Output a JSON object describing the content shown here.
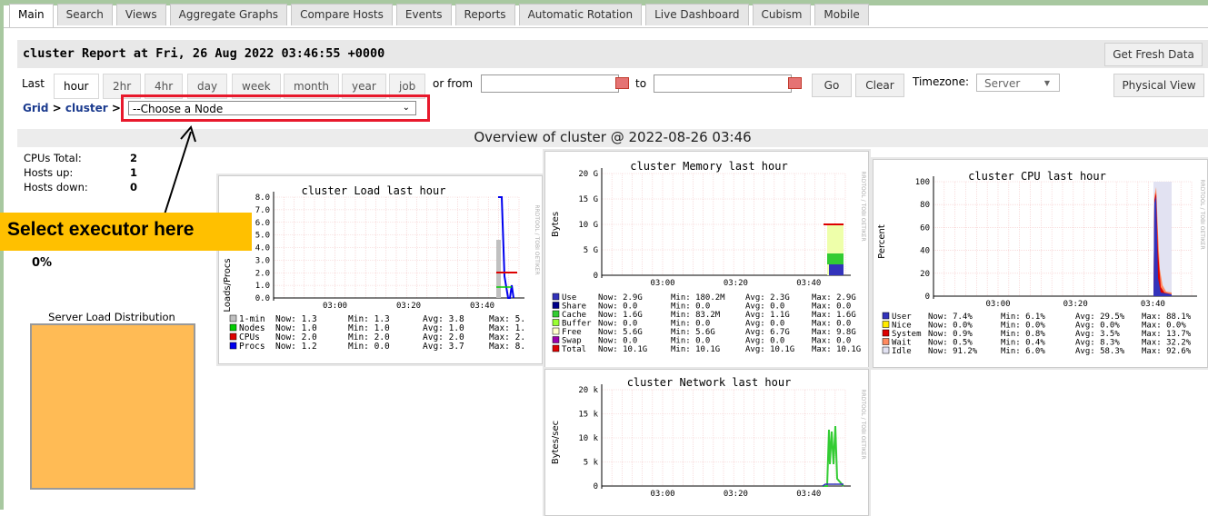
{
  "tabs": [
    "Main",
    "Search",
    "Views",
    "Aggregate Graphs",
    "Compare Hosts",
    "Events",
    "Reports",
    "Automatic Rotation",
    "Live Dashboard",
    "Cubism",
    "Mobile"
  ],
  "report_title": "cluster Report at Fri, 26 Aug 2022 03:46:55 +0000",
  "get_fresh_data": "Get Fresh Data",
  "range": {
    "last_label": "Last",
    "options": [
      "hour",
      "2hr",
      "4hr",
      "day",
      "week",
      "month",
      "year",
      "job"
    ],
    "or_from": "or from",
    "to": "to",
    "go": "Go",
    "clear": "Clear",
    "timezone_label": "Timezone:",
    "timezone_value": "Server",
    "physical_view": "Physical View"
  },
  "breadcrumb": {
    "grid": "Grid",
    "sep": ">",
    "cluster": "cluster",
    "node_select": "--Choose a Node"
  },
  "overview_title": "Overview of cluster @ 2022-08-26 03:46",
  "stats": [
    {
      "label": "CPUs Total:",
      "value": "2"
    },
    {
      "label": "Hosts up:",
      "value": "1"
    },
    {
      "label": "Hosts down:",
      "value": "0"
    }
  ],
  "callout": "Select executor here",
  "load_pct": "0%",
  "server_load_title": "Server Load Distribution",
  "watermark": "RRDTOOL / TOBI OETIKER",
  "colors": {
    "accent_red": "#e8192c",
    "callout": "#ffc000",
    "load_box": "#ffbb55"
  },
  "graphs": {
    "load": {
      "title": "cluster Load last hour",
      "ylabel": "Loads/Procs",
      "yticks": [
        "8.0",
        "7.0",
        "6.0",
        "5.0",
        "4.0",
        "3.0",
        "2.0",
        "1.0",
        "0.0"
      ],
      "xticks": [
        "03:00",
        "03:20",
        "03:40"
      ],
      "legend": [
        {
          "name": "1-min",
          "color": "#c0c0c0",
          "now": "1.3",
          "min": "1.3",
          "avg": "3.8",
          "max": "5."
        },
        {
          "name": "Nodes",
          "color": "#00cc00",
          "now": "1.0",
          "min": "1.0",
          "avg": "1.0",
          "max": "1."
        },
        {
          "name": "CPUs",
          "color": "#dd0000",
          "now": "2.0",
          "min": "2.0",
          "avg": "2.0",
          "max": "2."
        },
        {
          "name": "Procs",
          "color": "#0000ee",
          "now": "1.2",
          "min": "0.0",
          "avg": "3.7",
          "max": "8."
        }
      ]
    },
    "memory": {
      "title": "cluster Memory last hour",
      "ylabel": "Bytes",
      "yticks": [
        "20 G",
        "15 G",
        "10 G",
        "5 G",
        "0"
      ],
      "xticks": [
        "03:00",
        "03:20",
        "03:40"
      ],
      "legend": [
        {
          "name": "Use",
          "color": "#3333bb",
          "now": "2.9G",
          "min": "180.2M",
          "avg": "2.3G",
          "max": "2.9G"
        },
        {
          "name": "Share",
          "color": "#000088",
          "now": "0.0",
          "min": "0.0",
          "avg": "0.0",
          "max": "0.0"
        },
        {
          "name": "Cache",
          "color": "#33cc33",
          "now": "1.6G",
          "min": "83.2M",
          "avg": "1.1G",
          "max": "1.6G"
        },
        {
          "name": "Buffer",
          "color": "#99ff33",
          "now": "0.0",
          "min": "0.0",
          "avg": "0.0",
          "max": "0.0"
        },
        {
          "name": "Free",
          "color": "#ffffcc",
          "now": "5.6G",
          "min": "5.6G",
          "avg": "6.7G",
          "max": "9.8G"
        },
        {
          "name": "Swap",
          "color": "#9900aa",
          "now": "0.0",
          "min": "0.0",
          "avg": "0.0",
          "max": "0.0"
        },
        {
          "name": "Total",
          "color": "#dd0000",
          "now": "10.1G",
          "min": "10.1G",
          "avg": "10.1G",
          "max": "10.1G"
        }
      ]
    },
    "cpu": {
      "title": "cluster CPU last hour",
      "ylabel": "Percent",
      "yticks": [
        "100",
        "80",
        "60",
        "40",
        "20",
        "0"
      ],
      "xticks": [
        "03:00",
        "03:20",
        "03:40"
      ],
      "legend": [
        {
          "name": "User",
          "color": "#3333bb",
          "now": "7.4%",
          "min": "6.1%",
          "avg": "29.5%",
          "max": "88.1%"
        },
        {
          "name": "Nice",
          "color": "#ffea00",
          "now": "0.0%",
          "min": "0.0%",
          "avg": "0.0%",
          "max": "0.0%"
        },
        {
          "name": "System",
          "color": "#dd0000",
          "now": "0.9%",
          "min": "0.8%",
          "avg": "3.5%",
          "max": "13.7%"
        },
        {
          "name": "Wait",
          "color": "#ff8a60",
          "now": "0.5%",
          "min": "0.4%",
          "avg": "8.3%",
          "max": "32.2%"
        },
        {
          "name": "Idle",
          "color": "#e2e2f2",
          "now": "91.2%",
          "min": "6.0%",
          "avg": "58.3%",
          "max": "92.6%"
        }
      ]
    },
    "network": {
      "title": "cluster Network last hour",
      "ylabel": "Bytes/sec",
      "yticks": [
        "20 k",
        "15 k",
        "10 k",
        "5 k",
        "0"
      ],
      "xticks": [
        "03:00",
        "03:20",
        "03:40"
      ]
    }
  }
}
